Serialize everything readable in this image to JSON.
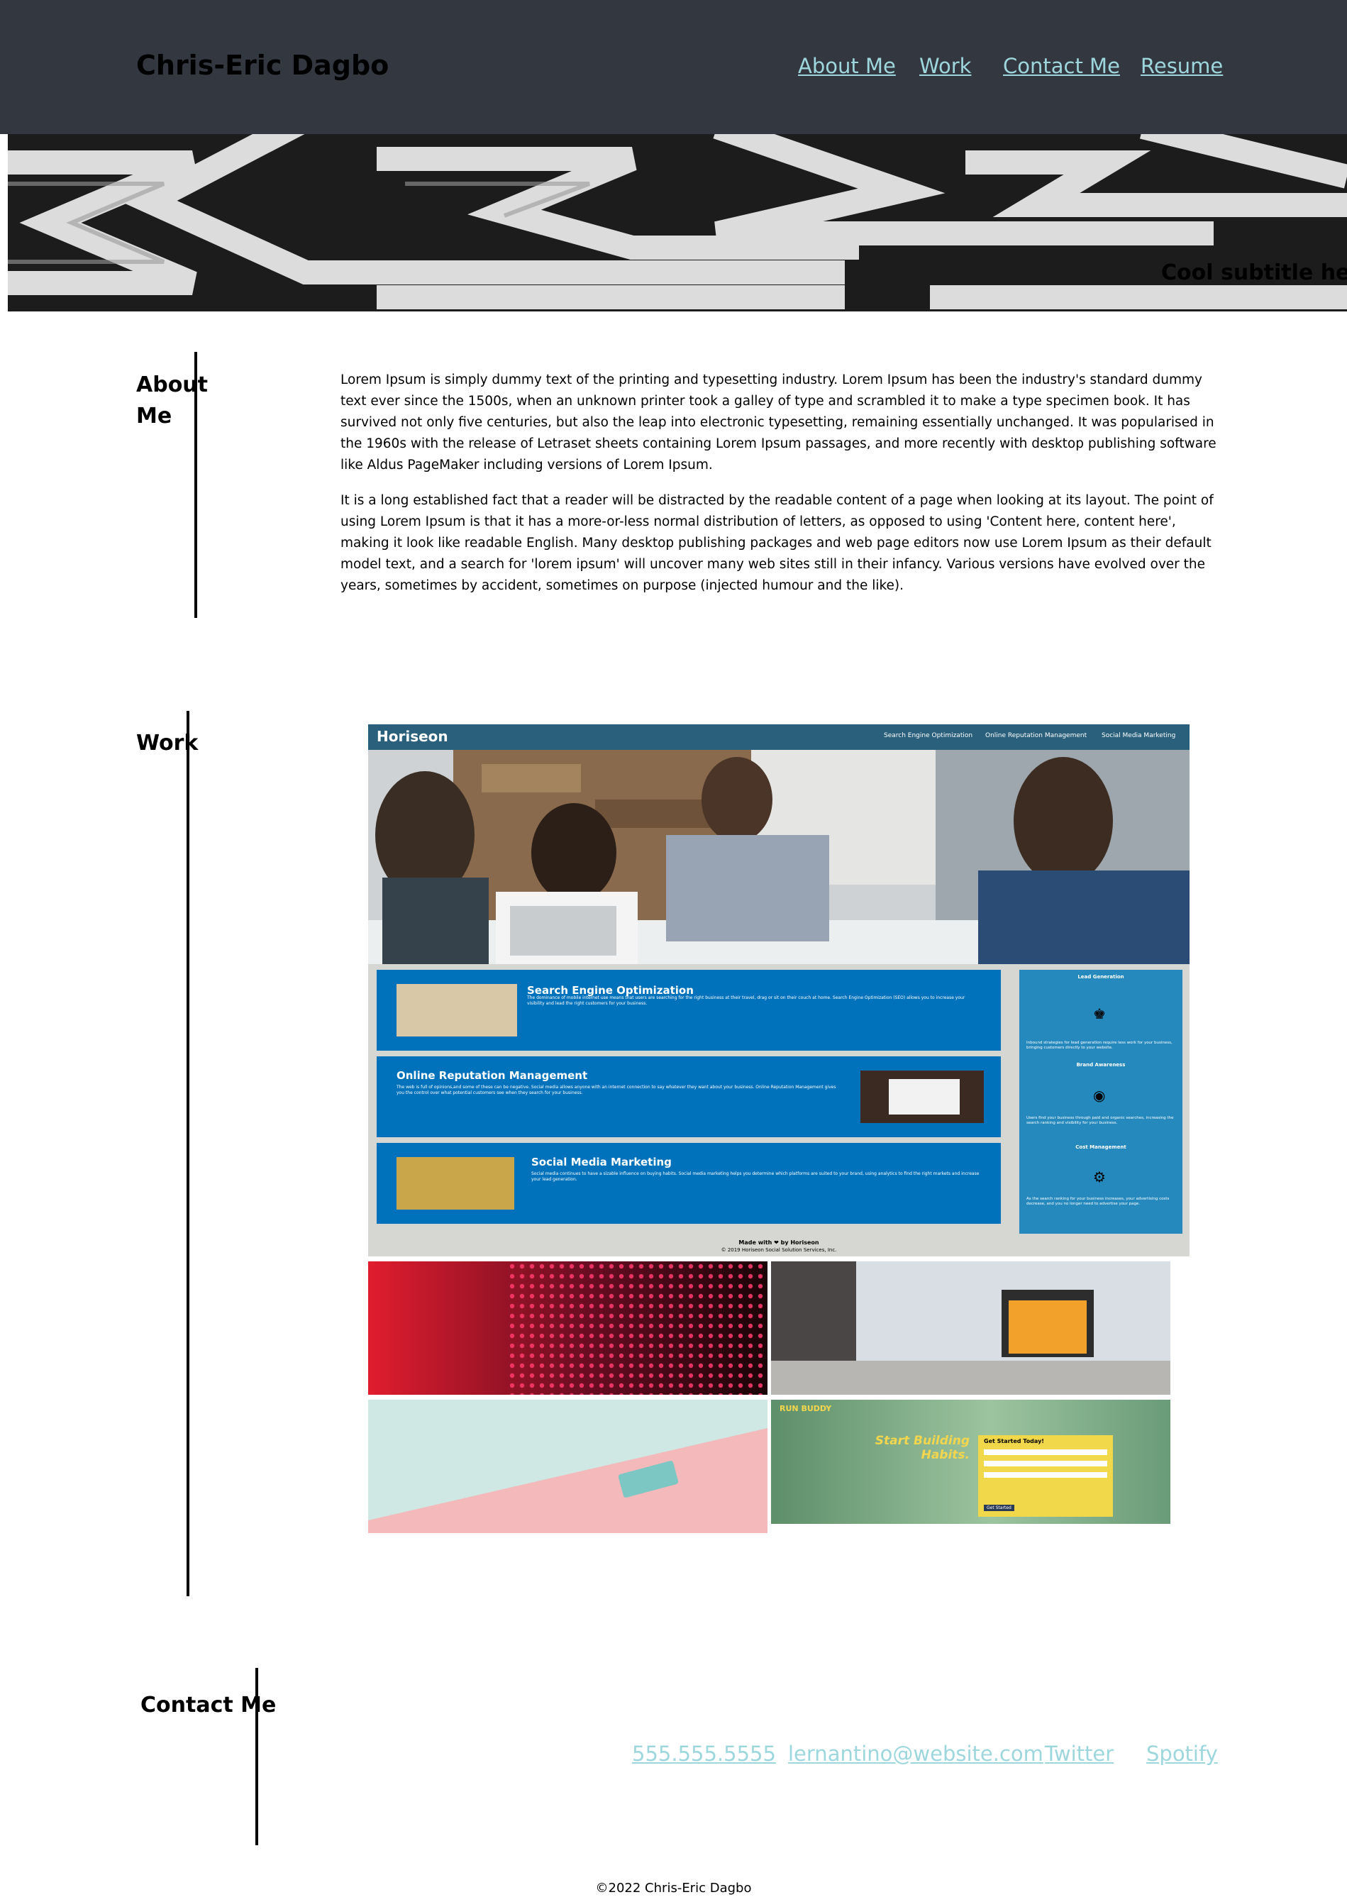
{
  "header": {
    "title": "Chris-Eric Dagbo",
    "nav": [
      "About Me",
      "Work",
      "Contact Me",
      "Resume"
    ]
  },
  "hero": {
    "subtitle": "Cool subtitle here!"
  },
  "about": {
    "heading": "About Me",
    "paragraphs": [
      "Lorem Ipsum is simply dummy text of the printing and typesetting industry. Lorem Ipsum has been the industry's standard dummy text ever since the 1500s, when an unknown printer took a galley of type and scrambled it to make a type specimen book. It has survived not only five centuries, but also the leap into electronic typesetting, remaining essentially unchanged. It was popularised in the 1960s with the release of Letraset sheets containing Lorem Ipsum passages, and more recently with desktop publishing software like Aldus PageMaker including versions of Lorem Ipsum.",
      "It is a long established fact that a reader will be distracted by the readable content of a page when looking at its layout. The point of using Lorem Ipsum is that it has a more-or-less normal distribution of letters, as opposed to using 'Content here, content here', making it look like readable English. Many desktop publishing packages and web page editors now use Lorem Ipsum as their default model text, and a search for 'lorem ipsum' will uncover many web sites still in their infancy. Various versions have evolved over the years, sometimes by accident, sometimes on purpose (injected humour and the like)."
    ]
  },
  "work": {
    "heading": "Work",
    "featured": {
      "brand": "Horiseon",
      "nav": [
        "Search Engine Optimization",
        "Online Reputation Management",
        "Social Media Marketing"
      ],
      "cards": [
        {
          "title": "Search Engine Optimization",
          "text": "The dominance of mobile internet use means that users are searching for the right business at their travel, drag or sit on their couch at home. Search Engine Optimization (SEO) allows you to increase your visibility and lead the right customers for your business."
        },
        {
          "title": "Online Reputation Management",
          "text": "The web is full of opinions,and some of these can be negative. Social media allows anyone with an internet connection to say whatever they want about your business. Online Reputation Management gives you the control over what potential customers see when they search for your business."
        },
        {
          "title": "Social Media Marketing",
          "text": "Social media continues to have a sizable influence on buying habits. Social media marketing helps you determine which platforms are suited to your brand, using analytics to find the right markets and increase your lead generation."
        }
      ],
      "benefits": [
        {
          "title": "Lead Generation",
          "text": "Inbound strategies for lead generation require less work for your business, bringing customers directly to your website."
        },
        {
          "title": "Brand Awareness",
          "text": "Users find your business through paid and organic searches, increasing the search ranking and visibility for your business."
        },
        {
          "title": "Cost Management",
          "text": "As the search ranking for your business increases, your advertising costs decrease, and you no longer need to advertise your page."
        }
      ],
      "footer": "Made with ❤ by Horiseon",
      "copyright": "© 2019 Horiseon Social Solution Services, Inc."
    },
    "runbuddy": {
      "brand": "RUN BUDDY",
      "headline": "Start Building Habits.",
      "form_title": "Get Started Today!",
      "button": "Get Started"
    }
  },
  "contact": {
    "heading": "Contact Me",
    "links": [
      "555.555.5555",
      "lernantino@website.com",
      "Twitter",
      "Spotify"
    ]
  },
  "footer": {
    "copyright": "©2022 Chris-Eric Dagbo"
  },
  "colors": {
    "header_bg": "#33373f",
    "link": "#9dd7dd",
    "horiseon_blue": "#0072bb",
    "horiseon_header": "#2a607c"
  }
}
